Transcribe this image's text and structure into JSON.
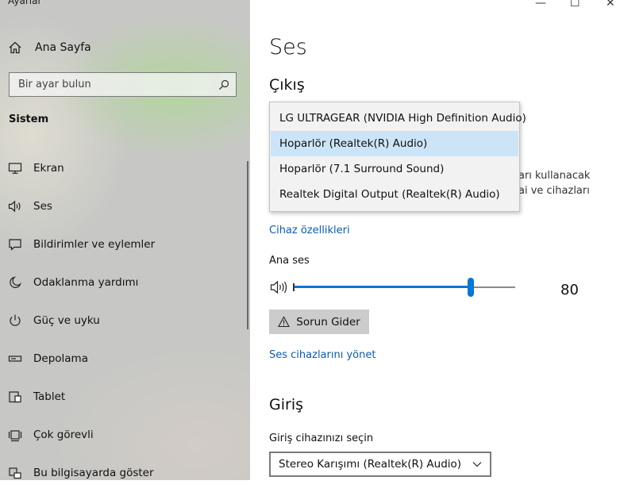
{
  "window": {
    "title": "Ayarlar",
    "minimize": "—",
    "maximize": "☐",
    "close": "✕"
  },
  "sidebar": {
    "home": "Ana Sayfa",
    "search_placeholder": "Bir ayar bulun",
    "section": "Sistem",
    "items": [
      {
        "label": "Ekran",
        "icon": "monitor-icon"
      },
      {
        "label": "Ses",
        "icon": "speaker-icon"
      },
      {
        "label": "Bildirimler ve eylemler",
        "icon": "notification-icon"
      },
      {
        "label": "Odaklanma yardımı",
        "icon": "moon-icon"
      },
      {
        "label": "Güç ve uyku",
        "icon": "power-icon"
      },
      {
        "label": "Depolama",
        "icon": "storage-icon"
      },
      {
        "label": "Tablet",
        "icon": "tablet-icon"
      },
      {
        "label": "Çok görevli",
        "icon": "multitask-icon"
      },
      {
        "label": "Bu bilgisayarda göster",
        "icon": "project-icon"
      }
    ]
  },
  "main": {
    "title": "Ses",
    "output": {
      "heading": "Çıkış",
      "options": [
        "LG ULTRAGEAR (NVIDIA High Definition Audio)",
        "Hoparlör (Realtek(R) Audio)",
        "Hoparlör (7.1 Surround Sound)",
        "Realtek Digital Output (Realtek(R) Audio)"
      ],
      "selected_index": 1,
      "hidden_text_1": "arı kullanacak",
      "hidden_text_2": "ai ve cihazları",
      "device_properties": "Cihaz özellikleri",
      "master_volume_label": "Ana ses",
      "volume": 80,
      "troubleshoot": "Sorun Gider",
      "manage_devices": "Ses cihazlarını yönet"
    },
    "input": {
      "heading": "Giriş",
      "choose_label": "Giriş cihazınızı seçin",
      "selected_device": "Stereo Karışımı (Realtek(R) Audio)"
    }
  },
  "colors": {
    "accent": "#0078d7",
    "link": "#0a5bb5",
    "selection": "#cce4f7"
  }
}
